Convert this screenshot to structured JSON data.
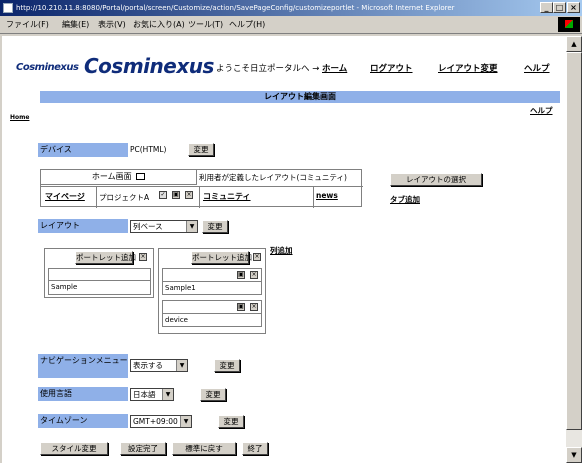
{
  "window": {
    "title": "http://10.210.11.8:8080/Portal/portal/screen/Customize/action/SavePageConfig/customizeportlet - Microsoft Internet Explorer",
    "minimize": "_",
    "maximize": "□",
    "close": "×"
  },
  "menubar": {
    "items": [
      "ファイル(F)",
      "編集(E)",
      "表示(V)",
      "お気に入り(A)",
      "ツール(T)",
      "ヘルプ(H)"
    ]
  },
  "header": {
    "logo_small": "Cosminexus",
    "logo_large": "Cosminexus",
    "welcome": "ようこそ日立ポータルへ →",
    "links": [
      "ホーム",
      "ログアウト",
      "レイアウト変更",
      "ヘルプ"
    ]
  },
  "page": {
    "title": "レイアウト編集画面",
    "help_link": "ヘルプ",
    "home_link": "Home"
  },
  "device": {
    "label": "デバイス",
    "value": "PC(HTML)",
    "change_button": "変更"
  },
  "tabs": {
    "home_header": "ホーム画面",
    "user_header": "利用者が定義したレイアウト(コミュニティ)",
    "my_page": "マイページ",
    "project_a": "プロジェクトA",
    "community": "コミュニティ",
    "news": "news",
    "select_layout_button": "レイアウトの選択",
    "add_tab_link": "タブ追加"
  },
  "layout": {
    "label": "レイアウト",
    "selected": "列ベース",
    "change_button": "変更",
    "add_column_link": "列追加",
    "columns": [
      {
        "add_portlet_button": "ポートレット追加",
        "portlets": [
          "Sample"
        ]
      },
      {
        "add_portlet_button": "ポートレット追加",
        "portlets": [
          "Sample1",
          "device"
        ]
      }
    ]
  },
  "navigation": {
    "label": "ナビゲーションメニュー",
    "selected": "表示する",
    "change_button": "変更"
  },
  "language": {
    "label": "使用言語",
    "selected": "日本語",
    "change_button": "変更"
  },
  "timezone": {
    "label": "タイムゾーン",
    "selected": "GMT+09:00",
    "change_button": "変更"
  },
  "footer_buttons": [
    "スタイル変更",
    "設定完了",
    "標準に戻す",
    "終了"
  ],
  "scrollbar": {
    "up": "▲",
    "down": "▼"
  }
}
